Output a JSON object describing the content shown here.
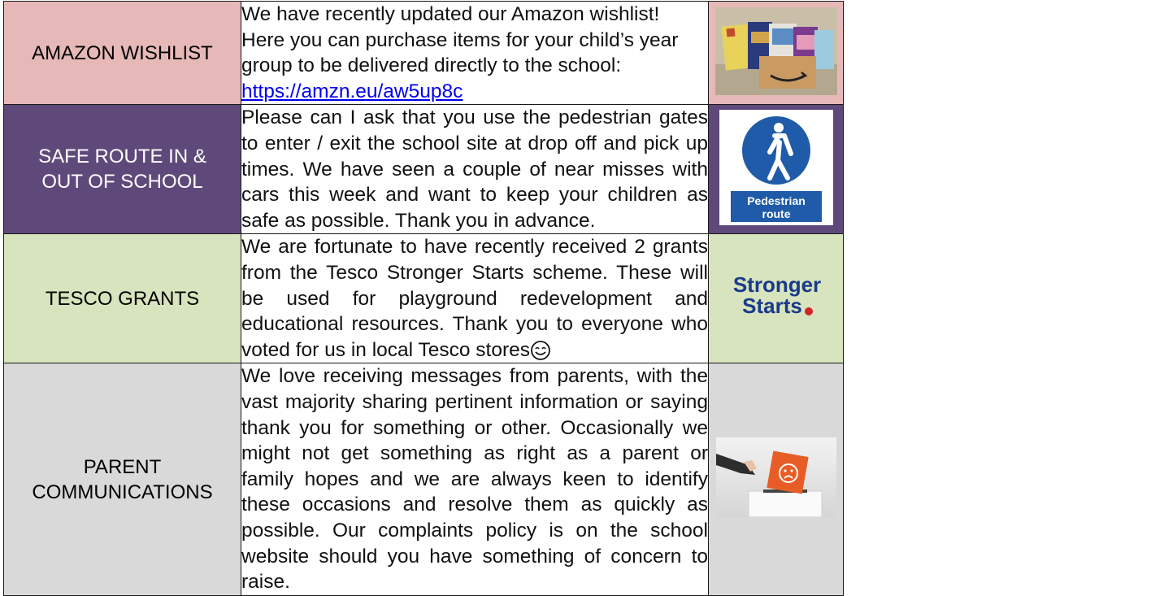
{
  "rows": [
    {
      "label_lines": [
        "AMAZON WISHLIST"
      ],
      "text": "We have recently updated our Amazon wishlist! Here you can purchase items for your child’s year group to be delivered directly to the school: ",
      "link": "https://amzn.eu/aw5up8c",
      "image_icon": "amazon-books-photo"
    },
    {
      "label_lines": [
        "SAFE ROUTE IN &",
        "OUT OF SCHOOL"
      ],
      "text": "Please can I ask that you use the pedestrian gates to enter / exit the school site at drop off and pick up times. We have seen a couple of near misses with cars this week and want to keep your children as safe as possible. Thank you in advance.",
      "sign_line1": "Pedestrian",
      "sign_line2": "route",
      "image_icon": "pedestrian-route-sign"
    },
    {
      "label_lines": [
        "TESCO GRANTS"
      ],
      "text": "We are fortunate to have recently received 2 grants from the Tesco Stronger Starts scheme. These will be used for playground redevelopment and educational resources. Thank you to everyone who voted for us in local Tesco stores",
      "logo_line1": "Stronger",
      "logo_line2": "Starts",
      "image_icon": "stronger-starts-logo"
    },
    {
      "label_lines": [
        "PARENT",
        "COMMUNICATIONS"
      ],
      "text": "We love receiving messages from parents, with the vast majority sharing pertinent information or saying thank you for something or other. Occasionally we might not get something as right as a parent or family hopes and we are always keen to identify these occasions and resolve them as quickly as possible. Our complaints policy is on the school website should you have something of concern to raise.",
      "image_icon": "complaint-box-photo"
    }
  ],
  "colors": {
    "row1": "#e6b9b8",
    "row2": "#5f497a",
    "row3": "#d7e4bd",
    "row4": "#d9d9d9",
    "link": "#0000ee",
    "sign_blue": "#1f5ba8",
    "logo_blue": "#1a3a8a"
  }
}
